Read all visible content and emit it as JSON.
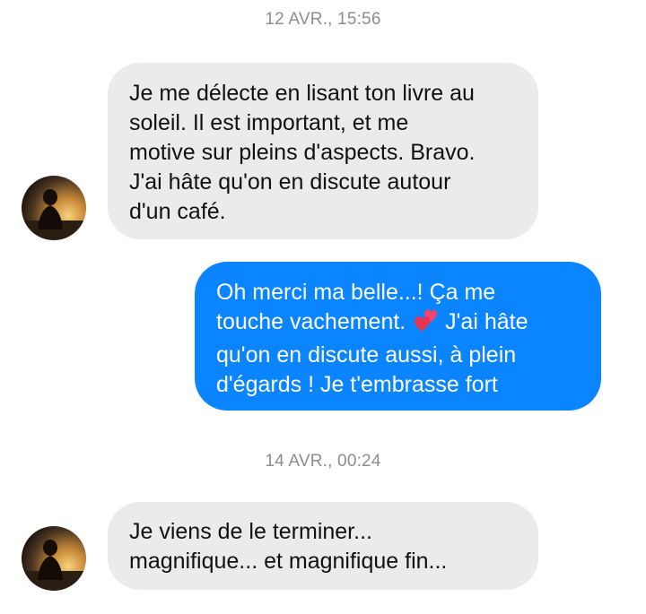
{
  "colors": {
    "sent_bubble": "#0a84ff",
    "received_bubble": "#ebebeb",
    "timestamp_text": "#8a8d91"
  },
  "conversation": {
    "timestamps": [
      "12 AVR., 15:56",
      "14 AVR., 00:24"
    ],
    "messages": [
      {
        "direction": "received",
        "avatar_icon": "contact-avatar",
        "text": "Je me délecte en lisant ton livre au\nsoleil. Il est important, et me\nmotive sur pleins d'aspects. Bravo.\nJ'ai hâte qu'on en discute autour\nd'un café."
      },
      {
        "direction": "sent",
        "text_before_emoji": "Oh merci ma belle...! Ça me\ntouche vachement. ",
        "emoji_icon": "two-hearts-icon",
        "text_after_emoji": " J'ai hâte\nqu'on en discute aussi, à plein\nd'égards ! Je t'embrasse fort"
      },
      {
        "direction": "received",
        "avatar_icon": "contact-avatar",
        "text": "Je viens de le terminer...\nmagnifique... et magnifique fin..."
      }
    ]
  }
}
